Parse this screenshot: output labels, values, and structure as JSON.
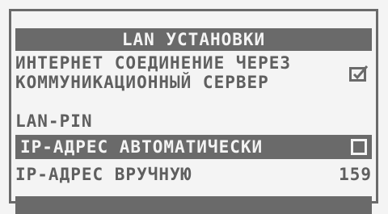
{
  "screen": {
    "title": "LAN УСТАНОВКИ",
    "items": [
      {
        "label_line1": "ИНТЕРНЕТ СОЕДИНЕНИЕ ЧЕРЕЗ",
        "label_line2": "КОММУНИКАЦИОННЫЙ СЕРВЕР",
        "checked": true
      },
      {
        "label": "LAN-PIN"
      },
      {
        "label": "IP-АДРЕС АВТОМАТИЧЕСКИ",
        "checked": false,
        "selected": true
      },
      {
        "label": "IP-АДРЕС ВРУЧНУЮ",
        "value": "159"
      }
    ]
  },
  "colors": {
    "foreground": "#6a6a6a",
    "background": "#f4f4f4"
  }
}
